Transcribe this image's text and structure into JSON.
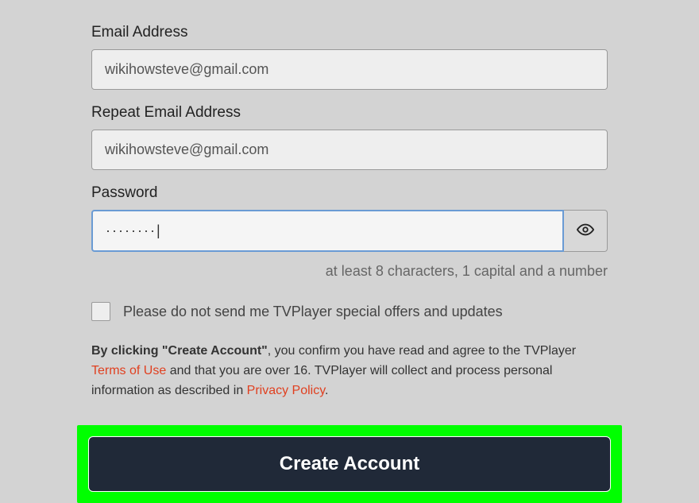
{
  "fields": {
    "email": {
      "label": "Email Address",
      "value": "wikihowsteve@gmail.com"
    },
    "repeat_email": {
      "label": "Repeat Email Address",
      "value": "wikihowsteve@gmail.com"
    },
    "password": {
      "label": "Password",
      "value": "········|",
      "hint": "at least 8 characters, 1 capital and a number"
    }
  },
  "checkbox": {
    "label": "Please do not send me TVPlayer special offers and updates"
  },
  "legal": {
    "bold_prefix": "By clicking \"Create Account\"",
    "text1": ", you confirm you have read and agree to the TVPlayer ",
    "terms_link": "Terms of Use",
    "text2": " and that you are over 16. TVPlayer will collect and process personal information as described in ",
    "privacy_link": "Privacy Policy",
    "text3": "."
  },
  "create_button": "Create Account"
}
